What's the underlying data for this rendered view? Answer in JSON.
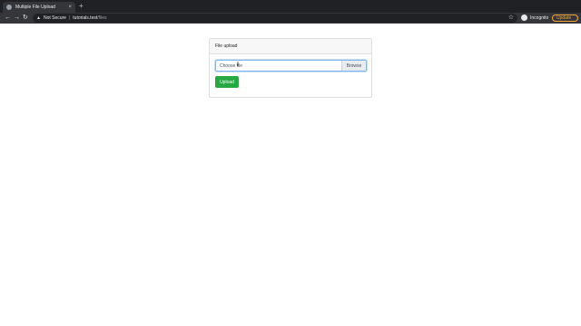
{
  "browser": {
    "tab_title": "Multiple File Upload",
    "tab_close": "×",
    "new_tab": "+",
    "back": "←",
    "forward": "→",
    "reload": "↻",
    "security_warning": "Not Secure",
    "url_host": "tutorials.test",
    "url_path": "/files",
    "incognito_label": "Incognito",
    "update_label": "Update"
  },
  "card": {
    "header": "File upload",
    "file_input_label": "Choose file",
    "browse_label": "Browse",
    "upload_label": "Upload"
  },
  "colors": {
    "upload_button": "#28a745",
    "input_focus_border": "#7fb4ec",
    "update_accent": "#f2a33a"
  }
}
